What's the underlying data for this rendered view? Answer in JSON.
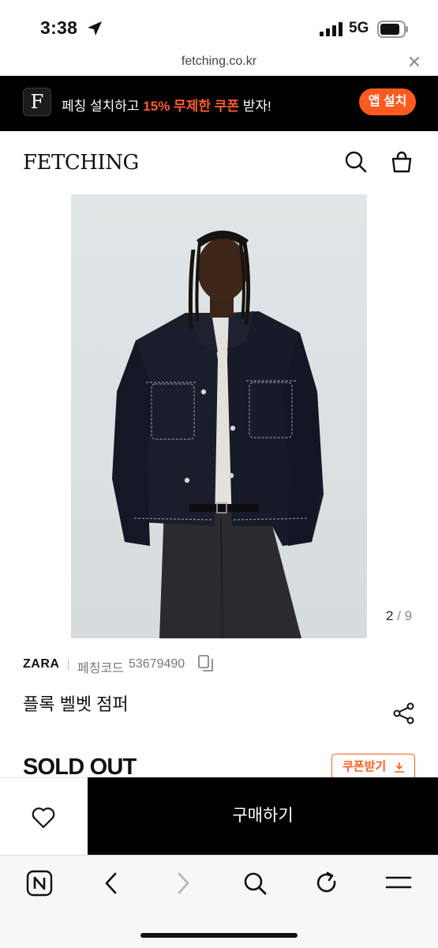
{
  "status_bar": {
    "time": "3:38",
    "network": "5G"
  },
  "browser": {
    "url": "fetching.co.kr"
  },
  "app_banner": {
    "logo_letter": "F",
    "text_prefix": "페칭 설치하고 ",
    "text_highlight": "15% 무제한 쿠폰",
    "text_suffix": " 받자!",
    "install_label": "앱 설치",
    "accent_color": "#ff5a1f"
  },
  "header": {
    "logo": "FETCHING",
    "icons": [
      "search-icon",
      "shopping-bag-icon"
    ]
  },
  "gallery": {
    "current": "2",
    "separator": " / ",
    "total": "9"
  },
  "product": {
    "brand": "ZARA",
    "code_label": "페칭코드",
    "code": "53679490",
    "title": "플록 벨벳 점퍼",
    "status": "SOLD OUT",
    "coupon_label": "쿠폰받기"
  },
  "purchase_bar": {
    "buy_label": "구매하기",
    "wish_icon": "heart-icon"
  },
  "toolbar_icons": [
    "naver-home-icon",
    "back-icon",
    "forward-icon",
    "search-icon",
    "refresh-icon",
    "menu-icon"
  ]
}
